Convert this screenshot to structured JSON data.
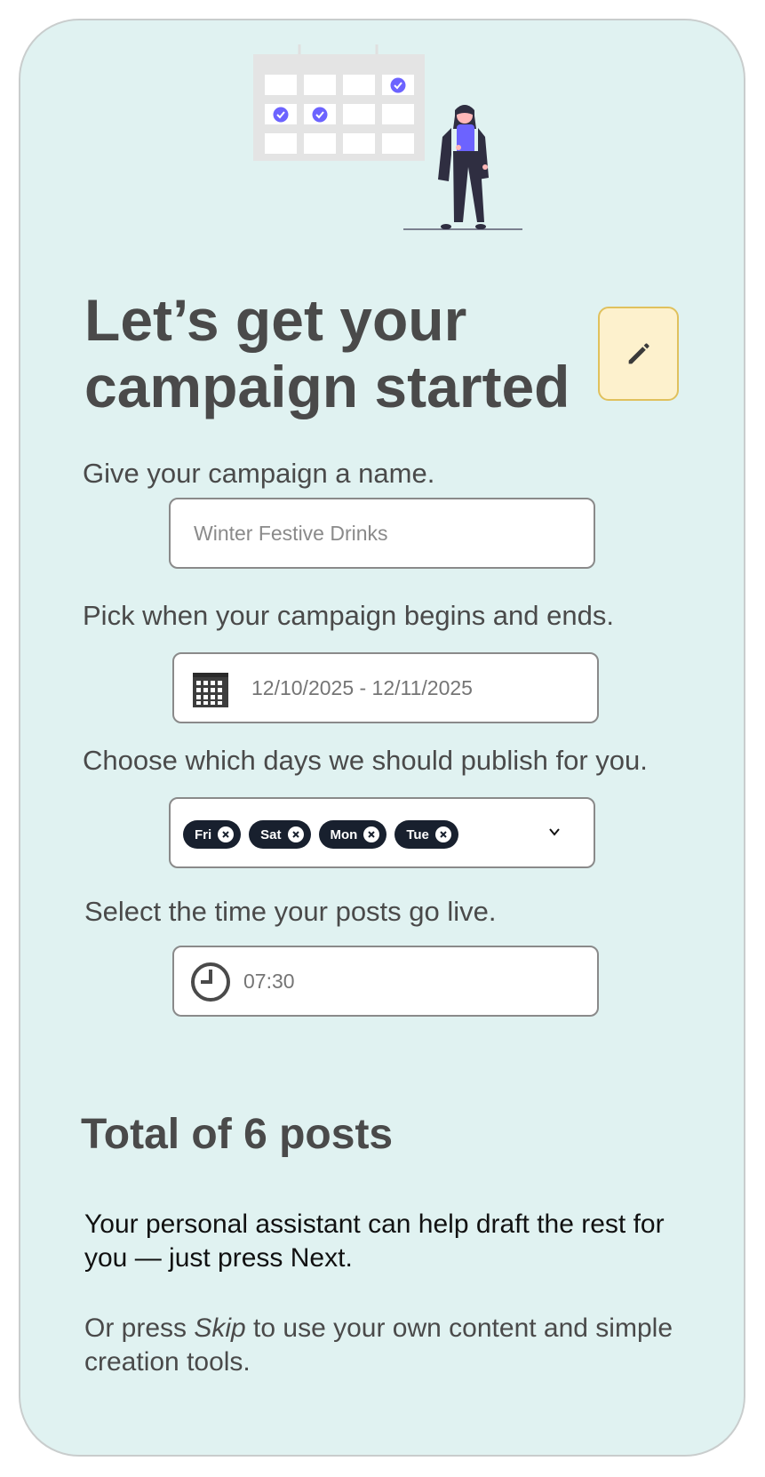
{
  "header": {
    "title": "Let’s get your campaign started",
    "edit_icon": "pencil-icon"
  },
  "campaign_name": {
    "label": "Give your campaign a name.",
    "placeholder": "Winter Festive Drinks",
    "value": ""
  },
  "date_range": {
    "label": "Pick when your campaign begins and ends.",
    "value": "12/10/2025 - 12/11/2025",
    "icon": "calendar-icon"
  },
  "publish_days": {
    "label": "Choose which days we should publish for you.",
    "selected": [
      "Fri",
      "Sat",
      "Mon",
      "Tue"
    ],
    "remove_icon": "close-circle-icon",
    "dropdown_icon": "chevron-down-icon"
  },
  "post_time": {
    "label": "Select the time your posts go live.",
    "value": "07:30",
    "icon": "clock-icon"
  },
  "summary": {
    "total_posts": "Total of 6 posts",
    "assistant_text": "Your personal assistant can help draft the rest for you — just press Next.",
    "skip_prefix": "Or press ",
    "skip_word": "Skip",
    "skip_suffix": " to use your own content and simple creation tools."
  },
  "colors": {
    "card_bg": "#e0f2f1",
    "accent_purple": "#6c63ff",
    "chip_bg": "#18202e",
    "edit_bg": "#fdf1cd",
    "edit_border": "#e0c15d",
    "text_dark": "#4a4a4a"
  }
}
